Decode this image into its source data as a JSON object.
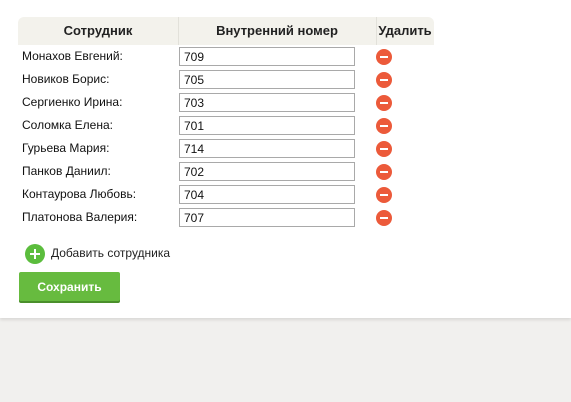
{
  "table": {
    "headers": {
      "employee": "Сотрудник",
      "extension": "Внутренний номер",
      "delete": "Удалить"
    },
    "rows": [
      {
        "name": "Монахов Евгений:",
        "extension": "709"
      },
      {
        "name": "Новиков Борис:",
        "extension": "705"
      },
      {
        "name": "Сергиенко Ирина:",
        "extension": "703"
      },
      {
        "name": "Соломка Елена:",
        "extension": "701"
      },
      {
        "name": "Гурьева Мария:",
        "extension": "714"
      },
      {
        "name": "Панков Даниил:",
        "extension": "702"
      },
      {
        "name": "Контаурова Любовь:",
        "extension": "704"
      },
      {
        "name": "Платонова Валерия:",
        "extension": "707"
      }
    ]
  },
  "actions": {
    "add_employee_label": "Добавить сотрудника",
    "save_label": "Сохранить"
  },
  "icons": {
    "delete": "minus-circle-icon",
    "add": "plus-circle-icon"
  },
  "colors": {
    "delete_icon": "#ec5a3a",
    "add_icon": "#5bbd3d",
    "save_button": "#67bb3f",
    "header_bg": "#f3f2ec"
  }
}
